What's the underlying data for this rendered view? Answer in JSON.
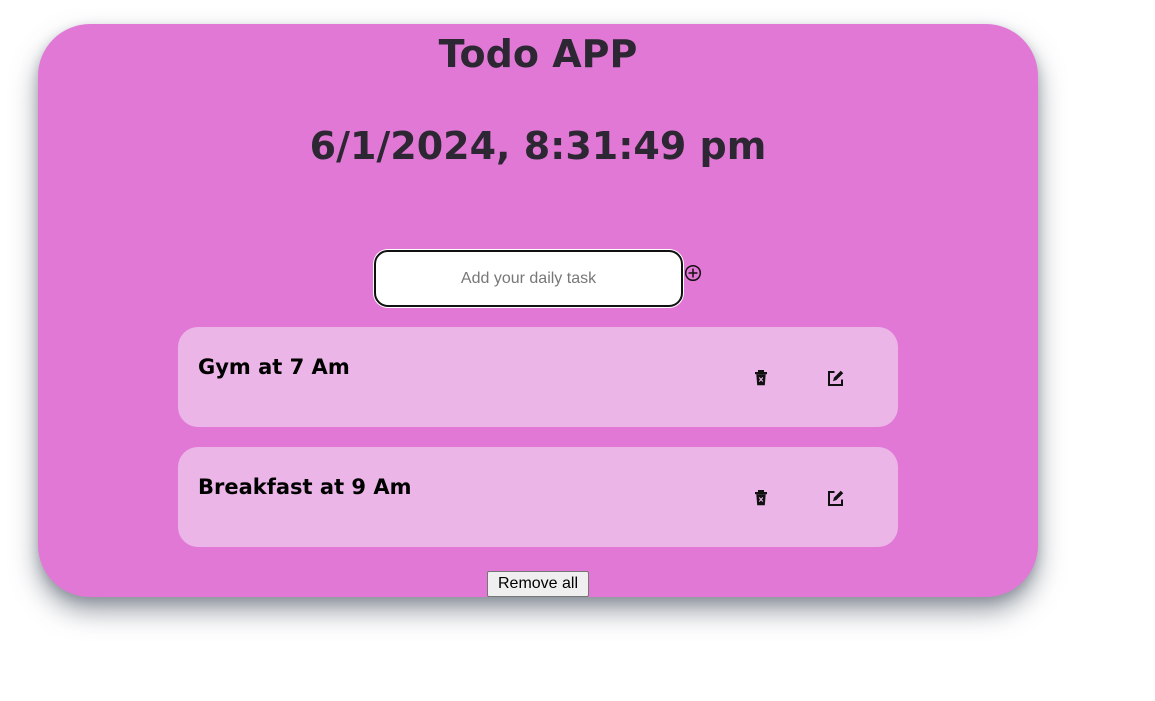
{
  "app": {
    "title": "Todo APP",
    "datetime": "6/1/2024, 8:31:49 pm"
  },
  "input": {
    "placeholder": "Add your daily task",
    "value": ""
  },
  "tasks": [
    {
      "text": "Gym at 7 Am",
      "delete_icon": "trash-icon",
      "edit_icon": "edit-icon"
    },
    {
      "text": "Breakfast at 9 Am",
      "delete_icon": "trash-icon",
      "edit_icon": "edit-icon"
    }
  ],
  "actions": {
    "add_icon": "plus-circle-icon",
    "remove_all_label": "Remove all"
  },
  "colors": {
    "card_background": "#e278d6",
    "task_background": "#ebb5e7",
    "heading_text": "#2c2733"
  }
}
